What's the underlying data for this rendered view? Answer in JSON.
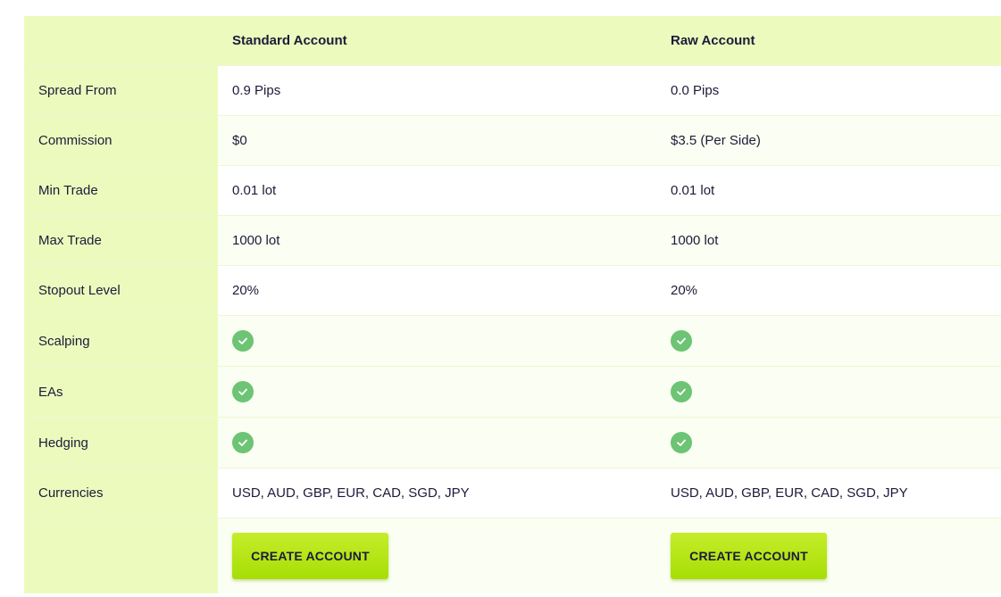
{
  "header": {
    "label": "",
    "standard": "Standard Account",
    "raw": "Raw Account"
  },
  "rows": [
    {
      "label": "Spread From",
      "standard": "0.9 Pips",
      "raw": "0.0 Pips"
    },
    {
      "label": "Commission",
      "standard": "$0",
      "raw": "$3.5 (Per Side)"
    },
    {
      "label": "Min Trade",
      "standard": "0.01 lot",
      "raw": "0.01 lot"
    },
    {
      "label": "Max Trade",
      "standard": "1000 lot",
      "raw": "1000 lot"
    },
    {
      "label": "Stopout Level",
      "standard": "20%",
      "raw": "20%"
    },
    {
      "label": "Scalping",
      "standard_icon": "check-icon",
      "raw_icon": "check-icon"
    },
    {
      "label": "EAs",
      "standard_icon": "check-icon",
      "raw_icon": "check-icon"
    },
    {
      "label": "Hedging",
      "standard_icon": "check-icon",
      "raw_icon": "check-icon"
    },
    {
      "label": "Currencies",
      "standard": "USD, AUD, GBP, EUR, CAD, SGD, JPY",
      "raw": "USD, AUD, GBP, EUR, CAD, SGD, JPY"
    }
  ],
  "actions": {
    "standard_button": "CREATE ACCOUNT",
    "raw_button": "CREATE ACCOUNT"
  },
  "colors": {
    "label_bg": "#ecfbbd",
    "button": "#b4e612",
    "check": "#6cc474"
  }
}
